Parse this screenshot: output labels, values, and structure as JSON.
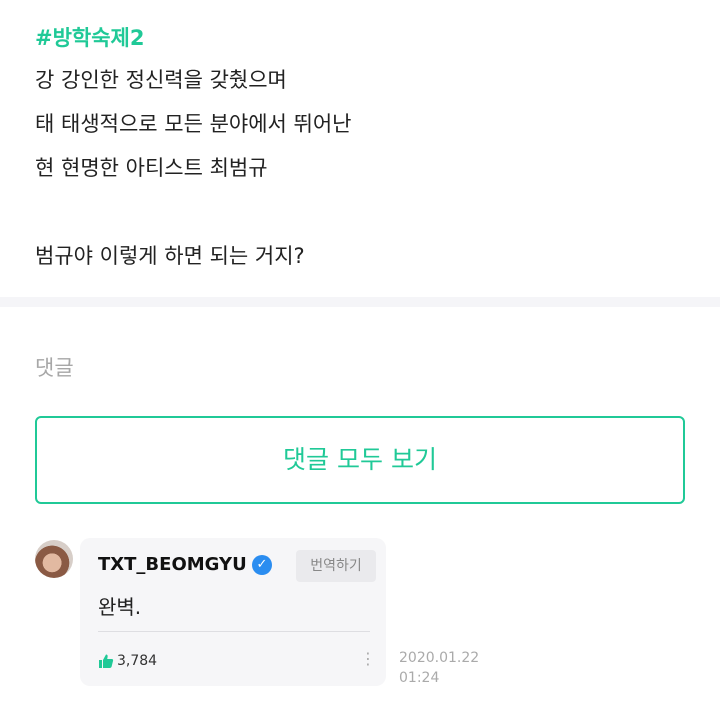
{
  "post": {
    "hashtag": "#방학숙제2",
    "lines": [
      "강 강인한 정신력을 갖췄으며",
      "태 태생적으로 모든 분야에서 뛰어난",
      "현 현명한 아티스트 최범규",
      "",
      "범규야 이렇게 하면 되는 거지?"
    ]
  },
  "comments_section": {
    "label": "댓글",
    "see_all_button": "댓글 모두 보기"
  },
  "comment": {
    "author": "TXT_BEOMGYU",
    "verified_glyph": "✓",
    "translate_button": "번역하기",
    "text": "완벽.",
    "like_count": "3,784",
    "more_glyph": "⋮",
    "date": "2020.01.22",
    "time": "01:24"
  },
  "colors": {
    "accent": "#20c997",
    "verified": "#2b8df0",
    "bubble_bg": "#f6f6f8"
  },
  "icons": {
    "like": "thumbs-up-icon",
    "verified": "verified-badge-icon",
    "more": "more-vertical-icon"
  }
}
